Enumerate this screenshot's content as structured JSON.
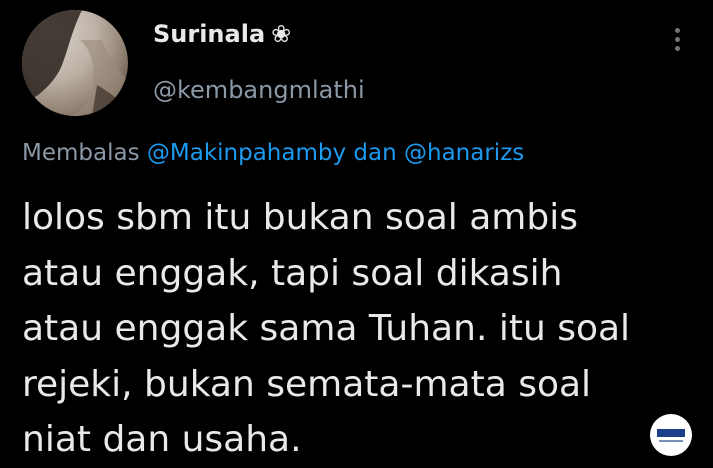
{
  "user": {
    "display_name": "Surinala",
    "name_emoji": "❀",
    "handle": "@kembangmlathi"
  },
  "reply": {
    "prefix": "Membalas",
    "mention1": "@Makinpahamby",
    "conjunction": "dan",
    "mention2": "@hanarizs"
  },
  "tweet": {
    "lines": [
      "lolos sbm itu bukan soal ambis",
      "atau enggak, tapi soal dikasih",
      "atau enggak sama Tuhan. itu soal",
      "rejeki, bukan semata-mata soal",
      "niat dan usaha."
    ]
  },
  "icons": {
    "more": "more-vertical-icon",
    "watermark": "watermark-logo"
  },
  "colors": {
    "background": "#000000",
    "text": "#e7e9ea",
    "secondary_text": "#8b98a5",
    "mention": "#1d9bf0"
  }
}
